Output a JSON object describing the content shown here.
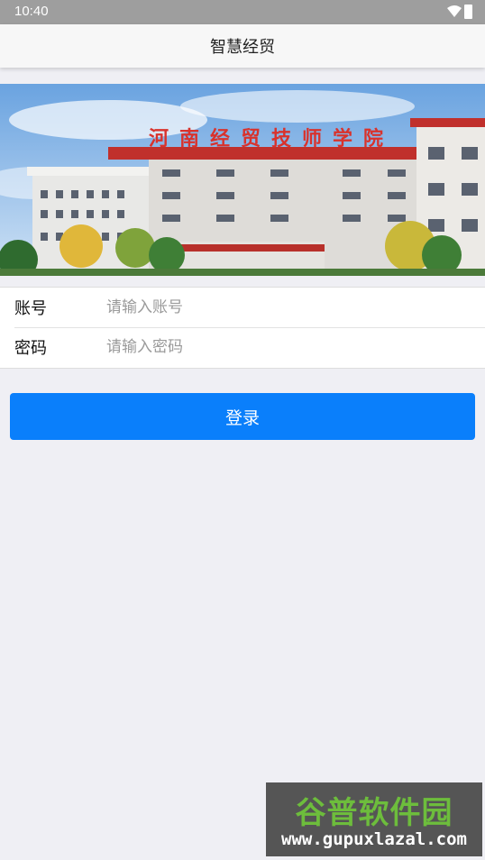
{
  "status_bar": {
    "time": "10:40"
  },
  "app_bar": {
    "title": "智慧经贸"
  },
  "banner": {
    "school_sign": "河南经贸技师学院"
  },
  "form": {
    "account_label": "账号",
    "account_placeholder": "请输入账号",
    "password_label": "密码",
    "password_placeholder": "请输入密码"
  },
  "login_button": {
    "label": "登录"
  },
  "watermark": {
    "brand": "谷普软件园",
    "url": "www.gupuxlazal.com"
  },
  "colors": {
    "accent": "#0a7ffb",
    "background": "#efeff4"
  }
}
